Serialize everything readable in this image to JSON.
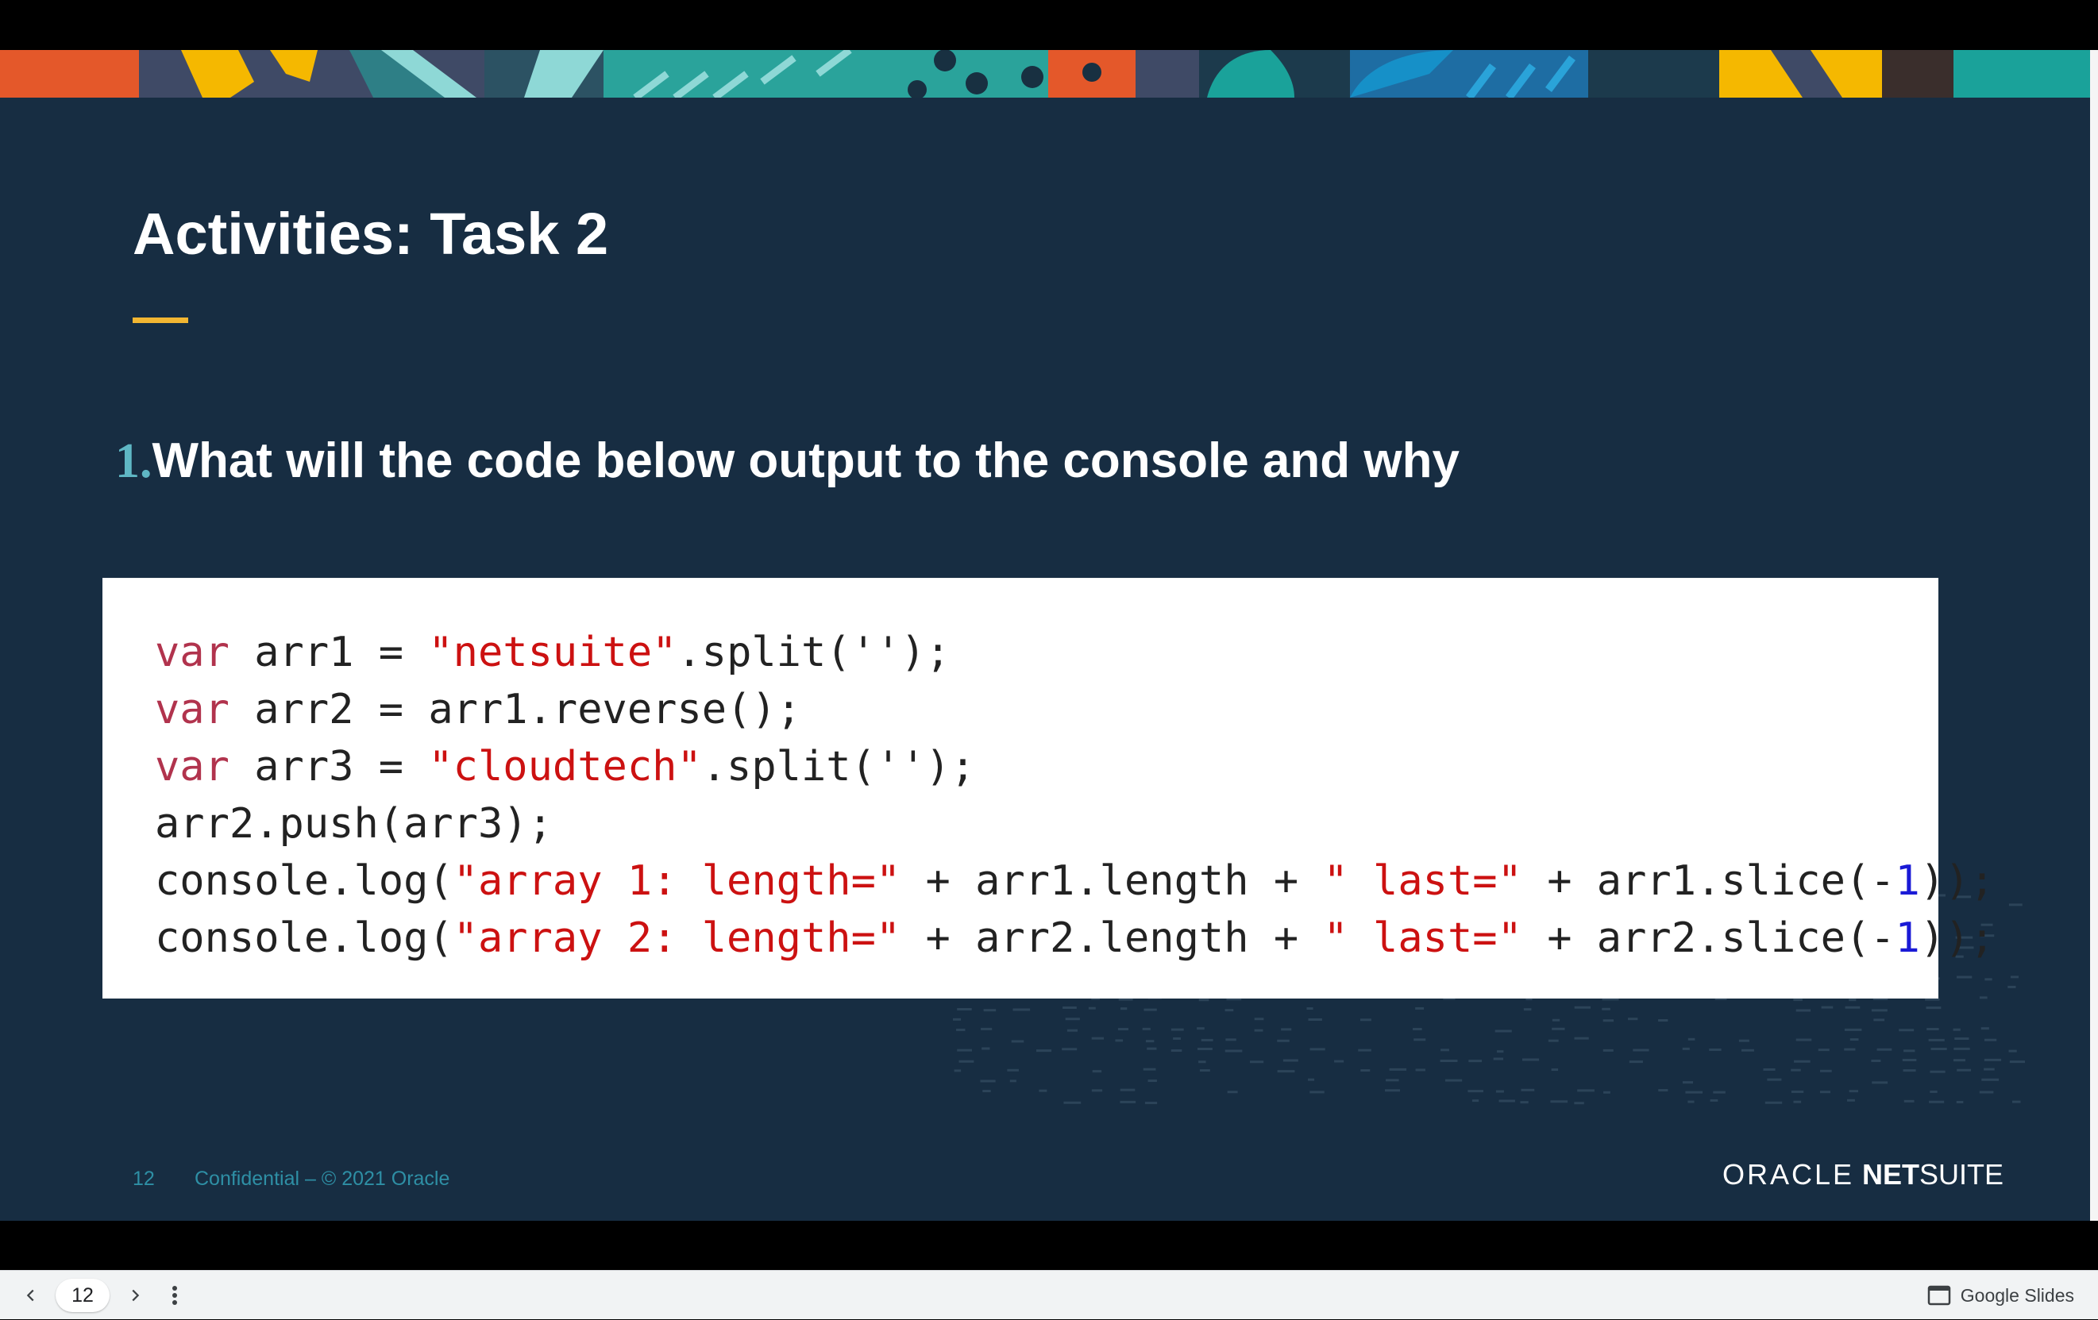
{
  "slide": {
    "title": "Activities: Task 2",
    "question_number": "1.",
    "question_text": "What will the code below output to the console and why",
    "code_lines": [
      [
        {
          "t": "var",
          "c": "kw"
        },
        {
          "t": " arr1 = ",
          "c": ""
        },
        {
          "t": "\"netsuite\"",
          "c": "str"
        },
        {
          "t": ".split('');",
          "c": ""
        }
      ],
      [
        {
          "t": "var",
          "c": "kw"
        },
        {
          "t": " arr2 = arr1.reverse();",
          "c": ""
        }
      ],
      [
        {
          "t": "var",
          "c": "kw"
        },
        {
          "t": " arr3 = ",
          "c": ""
        },
        {
          "t": "\"cloudtech\"",
          "c": "str"
        },
        {
          "t": ".split('');",
          "c": ""
        }
      ],
      [
        {
          "t": "arr2.push(arr3);",
          "c": ""
        }
      ],
      [
        {
          "t": "console.log(",
          "c": ""
        },
        {
          "t": "\"array 1: length=\"",
          "c": "str"
        },
        {
          "t": " + arr1.length + ",
          "c": ""
        },
        {
          "t": "\" last=\"",
          "c": "str"
        },
        {
          "t": " + arr1.slice(-",
          "c": ""
        },
        {
          "t": "1",
          "c": "num1"
        },
        {
          "t": "));",
          "c": ""
        }
      ],
      [
        {
          "t": "console.log(",
          "c": ""
        },
        {
          "t": "\"array 2: length=\"",
          "c": "str"
        },
        {
          "t": " + arr2.length + ",
          "c": ""
        },
        {
          "t": "\" last=\"",
          "c": "str"
        },
        {
          "t": " + arr2.slice(-",
          "c": ""
        },
        {
          "t": "1",
          "c": "num1"
        },
        {
          "t": "));",
          "c": ""
        }
      ]
    ],
    "footer_page": "12",
    "footer_confidential": "Confidential – © 2021 Oracle",
    "brand_oracle": "ORACLE",
    "brand_net": "NET",
    "brand_suite": "SUITE"
  },
  "toolbar": {
    "current_page": "12",
    "app_label": "Google Slides"
  },
  "colors": {
    "slide_bg": "#172d42",
    "accent_yellow": "#f2b632",
    "accent_teal": "#5fb7c4",
    "code_keyword": "#b1334d",
    "code_string": "#cc1111",
    "code_number": "#1a1ad6"
  }
}
